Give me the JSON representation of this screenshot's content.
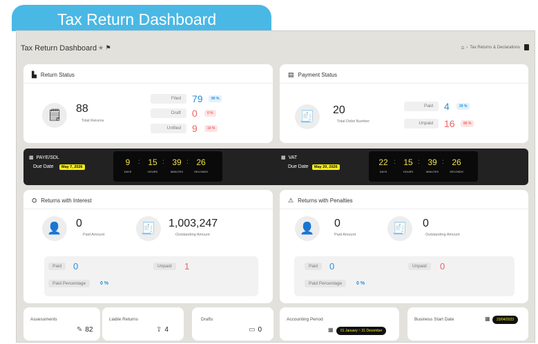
{
  "banner": "Tax Return Dashboard",
  "header": {
    "title": "Tax Return Dashboard",
    "breadcrumb": "Tax Returns & Declarations"
  },
  "return_status": {
    "title": "Return Status",
    "total": "88",
    "total_label": "Total Returns",
    "rows": [
      {
        "label": "Filed",
        "value": "79",
        "pct": "90 %"
      },
      {
        "label": "Draft",
        "value": "0",
        "pct": "0 %"
      },
      {
        "label": "Unfiled",
        "value": "9",
        "pct": "10 %"
      }
    ]
  },
  "payment_status": {
    "title": "Payment Status",
    "total": "20",
    "total_label": "Total Debit Number",
    "rows": [
      {
        "label": "Paid",
        "value": "4",
        "pct": "20 %"
      },
      {
        "label": "Unpaid",
        "value": "16",
        "pct": "80 %"
      }
    ]
  },
  "deadlines": [
    {
      "name": "PAYE/SDL",
      "due_label": "Due Date",
      "due_date": "May 7, 2026",
      "days": "9",
      "hours": "15",
      "minutes": "39",
      "seconds": "26"
    },
    {
      "name": "VAT",
      "due_label": "Due Date",
      "due_date": "May 20, 2026",
      "days": "22",
      "hours": "15",
      "minutes": "39",
      "seconds": "26"
    }
  ],
  "countdown_labels": {
    "days": "DAYS",
    "hours": "HOURS",
    "minutes": "MINUTES",
    "seconds": "SECONDS"
  },
  "interest": {
    "title": "Returns with Interest",
    "paid_amount": "0",
    "paid_amount_label": "Paid Amount",
    "outstanding_amount": "1,003,247",
    "outstanding_label": "Outstanding Amount",
    "paid_label": "Paid",
    "paid_value": "0",
    "unpaid_label": "Unpaid",
    "unpaid_value": "1",
    "percentage_label": "Paid Percentage",
    "percentage_value": "0 %"
  },
  "penalties": {
    "title": "Returns with Penalties",
    "paid_amount": "0",
    "paid_amount_label": "Paid Amount",
    "outstanding_amount": "0",
    "outstanding_label": "Outstanding Amount",
    "paid_label": "Paid",
    "paid_value": "0",
    "unpaid_label": "Unpaid",
    "unpaid_value": "0",
    "percentage_label": "Paid Percentage",
    "percentage_value": "0 %"
  },
  "bottom": {
    "assessments_label": "Assessments",
    "assessments_value": "82",
    "liable_label": "Liable Returns",
    "liable_value": "4",
    "drafts_label": "Drafts",
    "drafts_value": "0",
    "accounting_label": "Accounting Period",
    "accounting_value": "01 January ~ 31 December",
    "business_label": "Business Start Date",
    "business_value": "23/04/2023"
  },
  "colors": {
    "accent": "#4ab8e4",
    "positive": "#2a8ed3",
    "negative": "#ef6464",
    "countdown": "#f2e04a",
    "due": "#f6ef1a"
  }
}
